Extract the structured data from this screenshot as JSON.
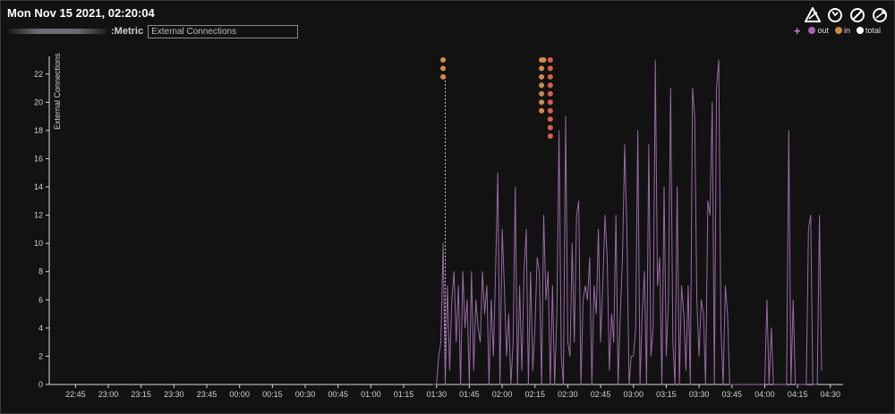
{
  "header": {
    "title": "Mon Nov 15 2021, 02:20:04",
    "metric_label": ":Metric",
    "metric_input_value": "External Connections"
  },
  "toolbar": {
    "icons": [
      "zoom-reset-icon",
      "refresh-icon",
      "disable-icon",
      "sync-icon"
    ]
  },
  "legend": {
    "items": [
      {
        "label": "out",
        "color": "#a763b3"
      },
      {
        "label": "in",
        "color": "#c98a44"
      },
      {
        "label": "total",
        "color": "#ffffff"
      }
    ]
  },
  "colors": {
    "line": "#9a6aa2",
    "in_markers": "#d08a4a",
    "total_markers": "#d9604e",
    "axis": "#d8d8d8"
  },
  "chart_data": {
    "type": "line",
    "ylabel": "External Connections",
    "ylim": [
      0,
      23
    ],
    "yticks": [
      0,
      2,
      4,
      6,
      8,
      10,
      12,
      14,
      16,
      18,
      20,
      22
    ],
    "x_range": [
      "2021-11-15T22:33",
      "2021-11-16T04:35"
    ],
    "xticks": [
      "22:45",
      "23:00",
      "23:15",
      "23:30",
      "23:45",
      "00:00",
      "00:15",
      "00:30",
      "00:45",
      "01:00",
      "01:15",
      "01:30",
      "01:45",
      "02:00",
      "02:15",
      "02:30",
      "02:45",
      "03:00",
      "03:15",
      "03:30",
      "03:45",
      "04:00",
      "04:15",
      "04:30"
    ],
    "cursor_time": "01:34",
    "series": [
      {
        "name": "out",
        "points": [
          [
            "01:28",
            0
          ],
          [
            "01:30",
            0
          ],
          [
            "01:31",
            2
          ],
          [
            "01:32",
            3
          ],
          [
            "01:33",
            10
          ],
          [
            "01:34",
            0
          ],
          [
            "01:35",
            7
          ],
          [
            "01:36",
            1
          ],
          [
            "01:37",
            6
          ],
          [
            "01:38",
            8
          ],
          [
            "01:39",
            3
          ],
          [
            "01:40",
            7
          ],
          [
            "01:41",
            0
          ],
          [
            "01:42",
            8
          ],
          [
            "01:43",
            4
          ],
          [
            "01:44",
            6
          ],
          [
            "01:45",
            0
          ],
          [
            "01:46",
            8
          ],
          [
            "01:47",
            1
          ],
          [
            "01:48",
            6
          ],
          [
            "01:49",
            4
          ],
          [
            "01:50",
            3
          ],
          [
            "01:51",
            8
          ],
          [
            "01:52",
            5
          ],
          [
            "01:53",
            7
          ],
          [
            "01:54",
            0
          ],
          [
            "01:55",
            6
          ],
          [
            "01:56",
            2
          ],
          [
            "01:57",
            8
          ],
          [
            "01:58",
            15
          ],
          [
            "01:59",
            0
          ],
          [
            "02:00",
            11
          ],
          [
            "02:01",
            7
          ],
          [
            "02:02",
            2
          ],
          [
            "02:03",
            5
          ],
          [
            "02:04",
            0
          ],
          [
            "02:05",
            3
          ],
          [
            "02:06",
            14
          ],
          [
            "02:07",
            0
          ],
          [
            "02:08",
            7
          ],
          [
            "02:09",
            1
          ],
          [
            "02:10",
            8
          ],
          [
            "02:11",
            11
          ],
          [
            "02:12",
            0
          ],
          [
            "02:13",
            8
          ],
          [
            "02:14",
            1
          ],
          [
            "02:15",
            4
          ],
          [
            "02:16",
            9
          ],
          [
            "02:17",
            8
          ],
          [
            "02:18",
            0
          ],
          [
            "02:19",
            12
          ],
          [
            "02:20",
            6
          ],
          [
            "02:21",
            8
          ],
          [
            "02:22",
            0
          ],
          [
            "02:23",
            7
          ],
          [
            "02:24",
            0
          ],
          [
            "02:25",
            5
          ],
          [
            "02:26",
            18
          ],
          [
            "02:27",
            2
          ],
          [
            "02:28",
            0
          ],
          [
            "02:29",
            19
          ],
          [
            "02:30",
            3
          ],
          [
            "02:31",
            2
          ],
          [
            "02:32",
            10
          ],
          [
            "02:33",
            3
          ],
          [
            "02:34",
            12
          ],
          [
            "02:35",
            13
          ],
          [
            "02:36",
            0
          ],
          [
            "02:37",
            6
          ],
          [
            "02:38",
            7
          ],
          [
            "02:39",
            6
          ],
          [
            "02:40",
            9
          ],
          [
            "02:41",
            0
          ],
          [
            "02:42",
            7
          ],
          [
            "02:43",
            5
          ],
          [
            "02:44",
            11
          ],
          [
            "02:45",
            3
          ],
          [
            "02:46",
            7
          ],
          [
            "02:47",
            12
          ],
          [
            "02:48",
            9
          ],
          [
            "02:49",
            1
          ],
          [
            "02:50",
            5
          ],
          [
            "02:51",
            3
          ],
          [
            "02:52",
            12
          ],
          [
            "02:53",
            0
          ],
          [
            "02:54",
            5
          ],
          [
            "02:55",
            9
          ],
          [
            "02:56",
            17
          ],
          [
            "02:57",
            11
          ],
          [
            "02:58",
            0
          ],
          [
            "02:59",
            2
          ],
          [
            "03:00",
            2
          ],
          [
            "03:01",
            4
          ],
          [
            "03:02",
            18
          ],
          [
            "03:03",
            0
          ],
          [
            "03:04",
            5
          ],
          [
            "03:05",
            8
          ],
          [
            "03:06",
            0
          ],
          [
            "03:07",
            17
          ],
          [
            "03:08",
            2
          ],
          [
            "03:09",
            4
          ],
          [
            "03:10",
            23
          ],
          [
            "03:11",
            7
          ],
          [
            "03:12",
            9
          ],
          [
            "03:13",
            0
          ],
          [
            "03:14",
            14
          ],
          [
            "03:15",
            2
          ],
          [
            "03:16",
            6
          ],
          [
            "03:17",
            21
          ],
          [
            "03:18",
            3
          ],
          [
            "03:19",
            0
          ],
          [
            "03:20",
            14
          ],
          [
            "03:21",
            0
          ],
          [
            "03:22",
            7
          ],
          [
            "03:23",
            5
          ],
          [
            "03:24",
            1
          ],
          [
            "03:25",
            7
          ],
          [
            "03:26",
            0
          ],
          [
            "03:27",
            21
          ],
          [
            "03:28",
            19
          ],
          [
            "03:29",
            6
          ],
          [
            "03:30",
            2
          ],
          [
            "03:31",
            6
          ],
          [
            "03:32",
            5
          ],
          [
            "03:33",
            0
          ],
          [
            "03:34",
            13
          ],
          [
            "03:35",
            12
          ],
          [
            "03:36",
            20
          ],
          [
            "03:37",
            0
          ],
          [
            "03:38",
            21
          ],
          [
            "03:39",
            23
          ],
          [
            "03:40",
            4
          ],
          [
            "03:41",
            0
          ],
          [
            "03:42",
            7
          ],
          [
            "03:43",
            5
          ],
          [
            "03:44",
            0
          ],
          [
            "03:45",
            0
          ],
          [
            "04:00",
            0
          ],
          [
            "04:01",
            6
          ],
          [
            "04:02",
            0
          ],
          [
            "04:03",
            4
          ],
          [
            "04:04",
            0
          ],
          [
            "04:10",
            0
          ],
          [
            "04:11",
            18
          ],
          [
            "04:12",
            0
          ],
          [
            "04:13",
            6
          ],
          [
            "04:14",
            0
          ],
          [
            "04:19",
            0
          ],
          [
            "04:20",
            11
          ],
          [
            "04:21",
            12
          ],
          [
            "04:22",
            0
          ],
          [
            "04:24",
            0
          ],
          [
            "04:25",
            12
          ],
          [
            "04:26",
            1
          ]
        ]
      },
      {
        "name": "in",
        "markers": [
          {
            "time": "01:33",
            "values": [
              23,
              22.4,
              21.8
            ]
          },
          {
            "time": "02:18",
            "values": [
              23,
              22.4,
              21.8,
              21.2,
              20.6,
              20,
              19.4
            ]
          },
          {
            "time": "02:19",
            "values": [
              23
            ]
          }
        ]
      },
      {
        "name": "total",
        "markers": [
          {
            "time": "02:22",
            "values": [
              23,
              22.4,
              21.8,
              21.2,
              20.6,
              20,
              19.4,
              18.8,
              18.2,
              17.6
            ]
          }
        ]
      }
    ]
  }
}
